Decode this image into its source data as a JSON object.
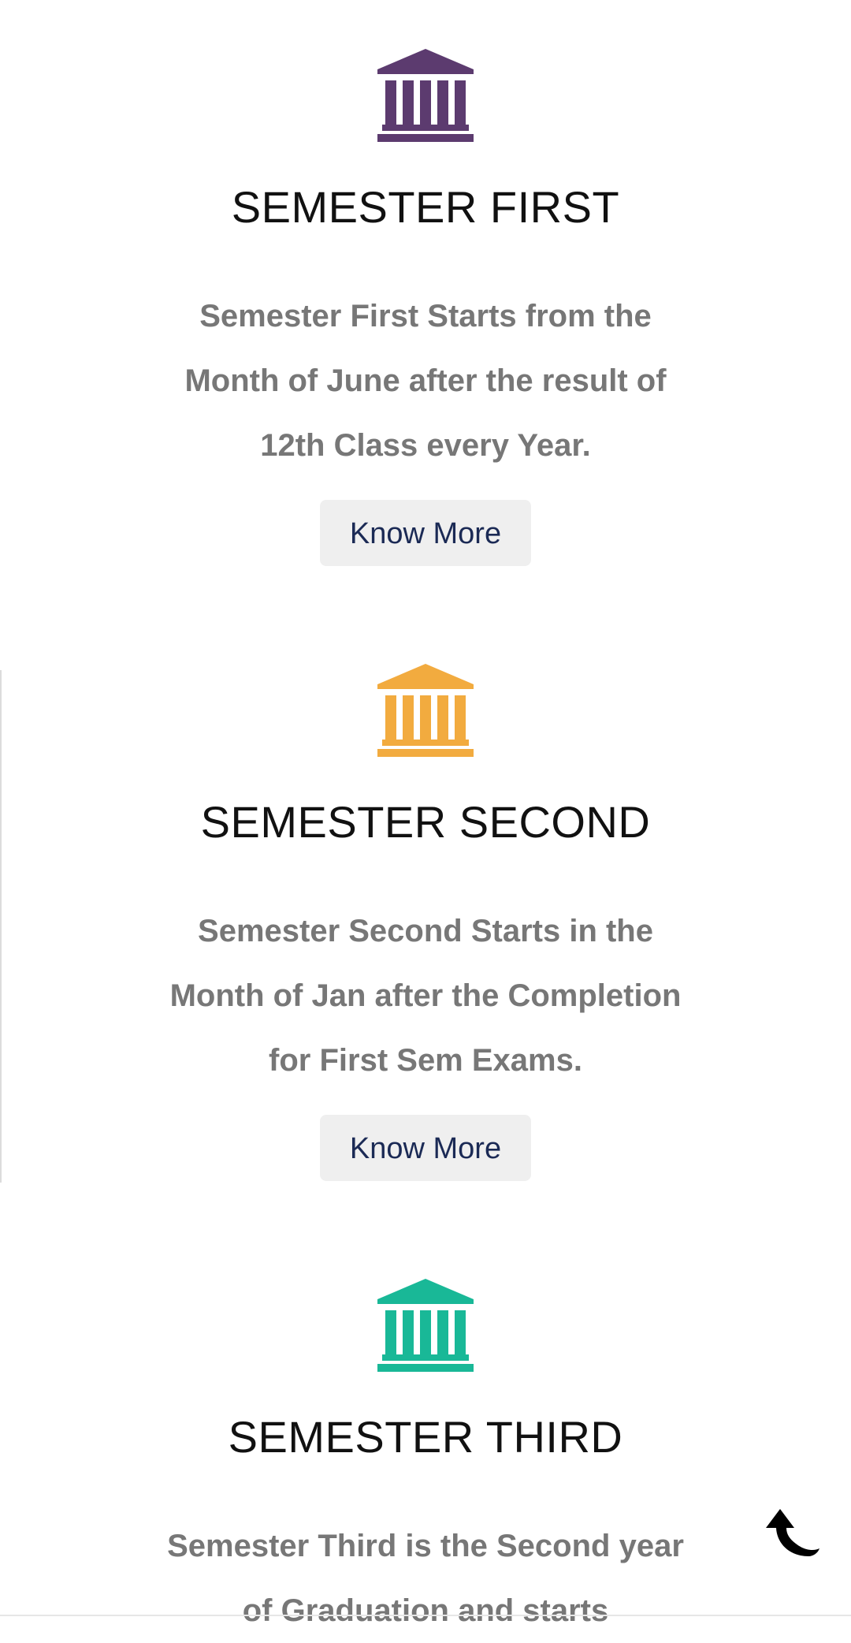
{
  "colors": {
    "icon_1": "#5c3b6f",
    "icon_2": "#f2ab3f",
    "icon_3": "#19b897"
  },
  "cards": [
    {
      "icon": "building-columns-icon",
      "title": "SEMESTER FIRST",
      "desc": "Semester First Starts from the Month of June after the result of 12th Class every Year.",
      "button": "Know More"
    },
    {
      "icon": "building-columns-icon",
      "title": "SEMESTER SECOND",
      "desc": "Semester Second Starts in the Month of Jan after the Completion for First Sem Exams.",
      "button": "Know More"
    },
    {
      "icon": "building-columns-icon",
      "title": "SEMESTER THIRD",
      "desc": "Semester Third is the Second year of Graduation and starts"
    }
  ],
  "scroll_top_icon": "curved-up-arrow-icon"
}
